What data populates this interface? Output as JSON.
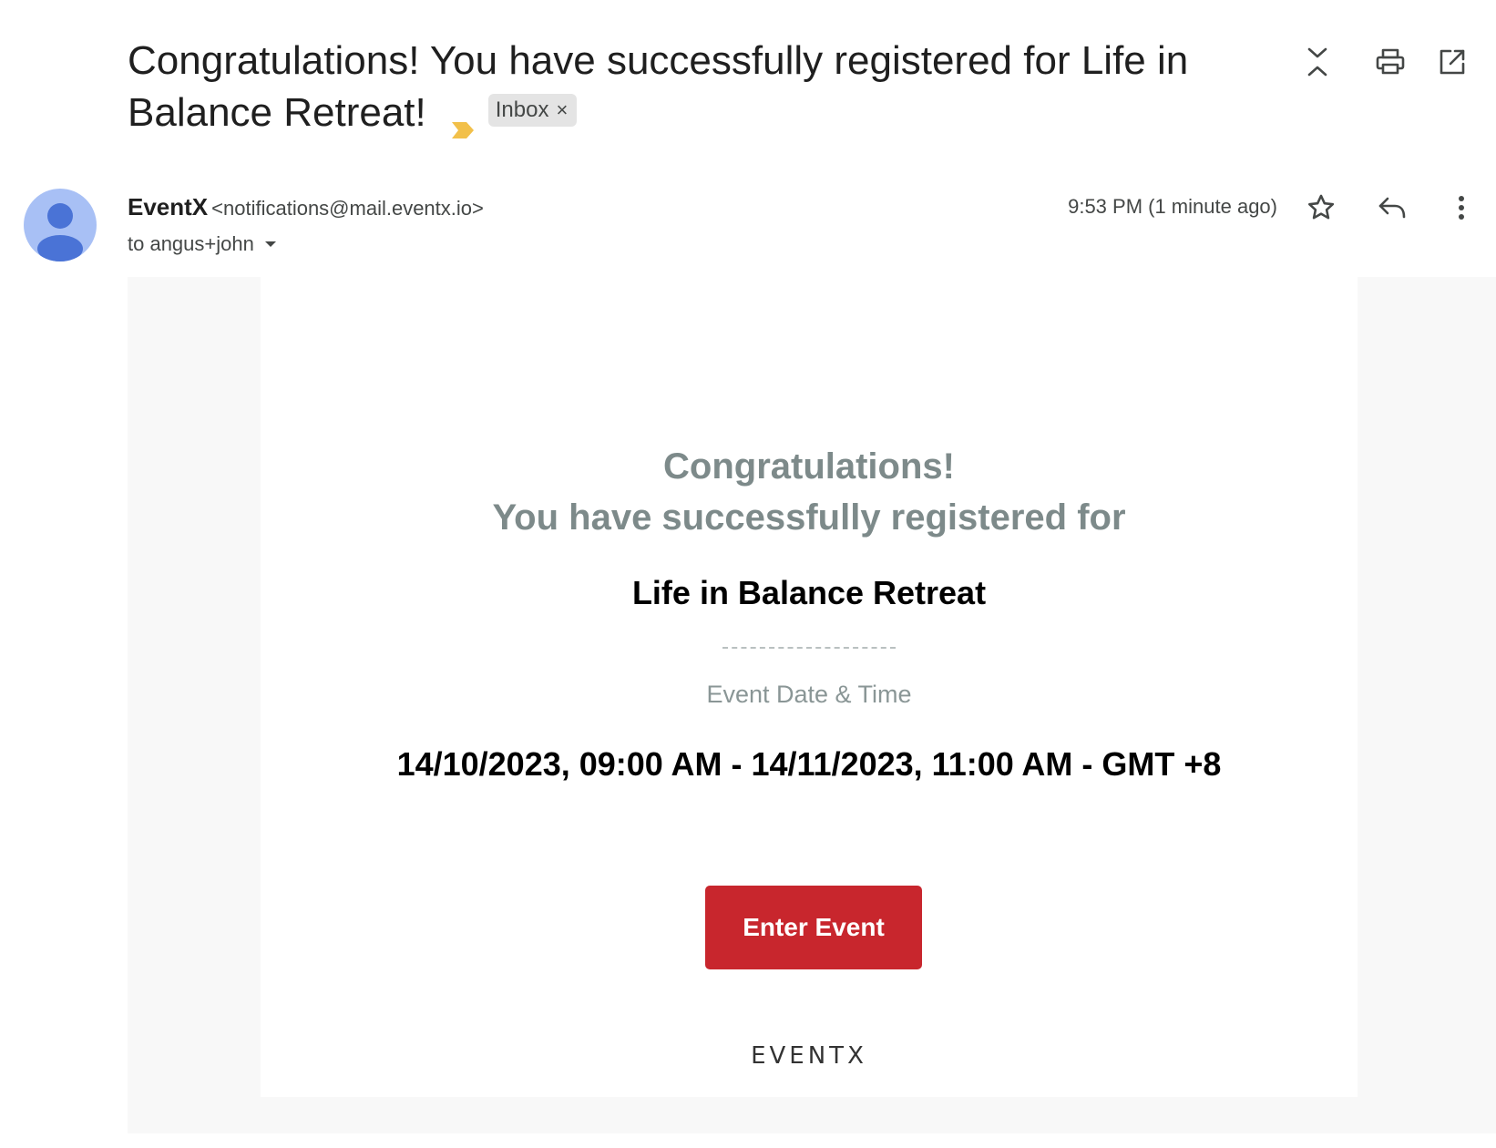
{
  "subject": {
    "text": "Congratulations! You have successfully registered for Life in Balance Retreat!",
    "label": "Inbox",
    "label_close": "×"
  },
  "top_actions": [
    "expand-collapse-icon",
    "print-icon",
    "open-in-new-window-icon"
  ],
  "message": {
    "sender_name": "EventX",
    "sender_email": "<notifications@mail.eventx.io>",
    "recipient": "to angus+john",
    "timestamp": "9:53 PM (1 minute ago)",
    "actions": [
      "star-icon",
      "reply-icon",
      "more-options-icon"
    ]
  },
  "email_body": {
    "headline_line1": "Congratulations!",
    "headline_line2": "You have successfully registered for",
    "event_name": "Life in Balance Retreat",
    "date_label": "Event Date & Time",
    "date_value": "14/10/2023, 09:00 AM - 14/11/2023, 11:00 AM - GMT +8",
    "cta_label": "Enter Event",
    "brand": "EVENTX"
  },
  "colors": {
    "cta_background": "#c8262d",
    "headline_text": "#7d8a8a",
    "important_marker": "#f2c04a",
    "avatar_background": "#a8c0f5",
    "avatar_figure": "#4a73d6"
  }
}
